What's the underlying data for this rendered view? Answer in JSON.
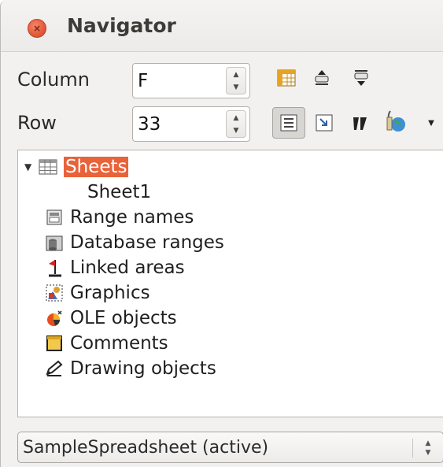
{
  "window": {
    "title": "Navigator",
    "close_glyph": "×"
  },
  "column": {
    "label": "Column",
    "value": "F"
  },
  "row": {
    "label": "Row",
    "value": "33"
  },
  "toolbar": {
    "icons": [
      "data-range-icon",
      "start-icon",
      "end-icon",
      "contents-icon",
      "toggle-icon",
      "scenarios-icon",
      "drag-mode-icon",
      "dropdown-arrow-icon"
    ],
    "pressed": "contents-icon"
  },
  "tree": {
    "items": [
      {
        "label": "Sheets",
        "icon": "sheets-icon",
        "selected": true,
        "expanded": true
      },
      {
        "label": "Sheet1",
        "icon": "",
        "child": true
      },
      {
        "label": "Range names",
        "icon": "range-names-icon"
      },
      {
        "label": "Database ranges",
        "icon": "database-ranges-icon"
      },
      {
        "label": "Linked areas",
        "icon": "linked-areas-icon"
      },
      {
        "label": "Graphics",
        "icon": "graphics-icon"
      },
      {
        "label": "OLE objects",
        "icon": "ole-objects-icon"
      },
      {
        "label": "Comments",
        "icon": "comments-icon"
      },
      {
        "label": "Drawing objects",
        "icon": "drawing-objects-icon"
      }
    ]
  },
  "document_select": {
    "value": "SampleSpreadsheet  (active)"
  },
  "colors": {
    "selection": "#e8623a",
    "close": "#e25a3a"
  }
}
